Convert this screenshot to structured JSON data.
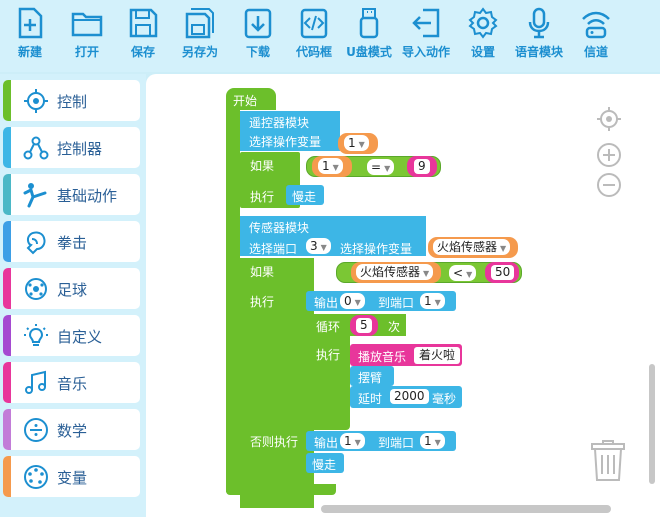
{
  "toolbar": {
    "new": "新建",
    "open": "打开",
    "save": "保存",
    "save_as": "另存为",
    "download": "下载",
    "code": "代码框",
    "usb": "U盘模式",
    "import": "导入动作",
    "settings": "设置",
    "voice": "语音模块",
    "channel": "信道"
  },
  "colors": {
    "accent": "#1c8fd0",
    "block_green": "#6cbf2b",
    "block_blue": "#3db6e6",
    "block_pink": "#e8369b",
    "field_orange": "#f59a4d"
  },
  "sidebar": {
    "items": [
      {
        "label": "控制",
        "color": "#6cbf2b",
        "icon": "crosshair-icon"
      },
      {
        "label": "控制器",
        "color": "#3db6e6",
        "icon": "network-icon"
      },
      {
        "label": "基础动作",
        "color": "#4bb8c7",
        "icon": "kick-icon"
      },
      {
        "label": "拳击",
        "color": "#3d9fe6",
        "icon": "boxing-glove-icon"
      },
      {
        "label": "足球",
        "color": "#e8369b",
        "icon": "football-icon"
      },
      {
        "label": "自定义",
        "color": "#a54ad1",
        "icon": "lightbulb-icon"
      },
      {
        "label": "音乐",
        "color": "#e8369b",
        "icon": "music-note-icon"
      },
      {
        "label": "数学",
        "color": "#c27cd8",
        "icon": "divide-icon"
      },
      {
        "label": "变量",
        "color": "#f59a4d",
        "icon": "palette-icon"
      }
    ]
  },
  "blocks": {
    "start": "开始",
    "remote_module": "遥控器模块",
    "select_var": "选择操作变量",
    "var1": "1",
    "if": "如果",
    "cmp_left": "1",
    "cmp_op": "=",
    "cmp_right": "9",
    "exec": "执行",
    "slow_stop": "慢走",
    "sensor_module": "传感器模块",
    "select_port": "选择端口",
    "port_val": "3",
    "select_var2": "选择操作变量",
    "flame_sensor": "火焰传感器",
    "if2": "如果",
    "cmp2_left": "火焰传感器",
    "cmp2_op": "<",
    "cmp2_right": "50",
    "exec2": "执行",
    "output": "输出",
    "out_val": "0",
    "to_port": "到端口",
    "out_port": "1",
    "loop": "循环",
    "loop_count": "5",
    "times": "次",
    "exec3": "执行",
    "play_music": "播放音乐",
    "music_name": "着火啦",
    "swing_arm": "摆臂",
    "delay": "延时",
    "delay_val": "2000",
    "ms": "毫秒",
    "else_exec": "否则执行",
    "output2": "输出",
    "out_val2": "1",
    "to_port2": "到端口",
    "out_port2": "1",
    "slow_stop2": "慢走"
  }
}
